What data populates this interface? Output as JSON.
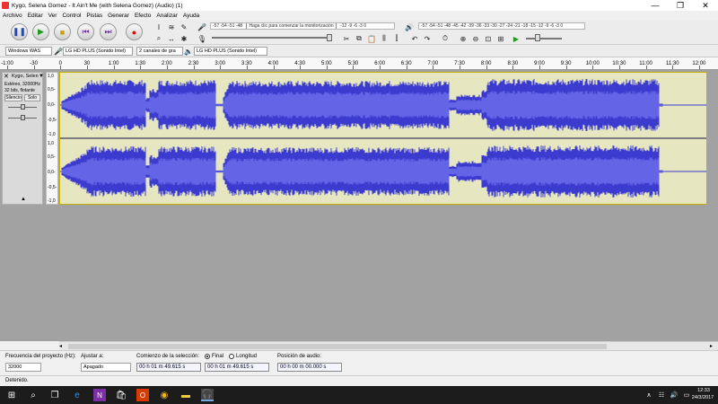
{
  "window": {
    "title": "Kygo, Selena Gomez - It Ain't Me (with Selena Gomez) (Audio) (1)",
    "controls": [
      "—",
      "❐",
      "✕"
    ]
  },
  "menu": [
    "Archivo",
    "Editar",
    "Ver",
    "Control",
    "Pistas",
    "Generar",
    "Efecto",
    "Analizar",
    "Ayuda"
  ],
  "toolbar": {
    "transport": [
      "pause-icon",
      "play-icon",
      "stop-icon",
      "skip-start-icon",
      "skip-end-icon",
      "record-icon"
    ],
    "record_meter_scale": "-57 -54 -51 -48",
    "record_meter_hint": "Haga clic para comenzar la monitorización",
    "record_meter_scale2": "-12 -9 -6 -3 0",
    "play_meter_scale": "-57 -54 -51 -48 -45 -42 -39 -36 -33 -30 -27 -24 -21 -18 -15 -12 -9 -6 -3 0"
  },
  "devices": {
    "host": "Windows WAS",
    "input": "LG HD PLUS (Sonido Intel)",
    "channels": "2 canales de gra",
    "output": "LG HD PLUS (Sonido Intel)"
  },
  "ruler": {
    "labels": [
      "-1:00",
      "-30",
      "0",
      "30",
      "1:00",
      "1:30",
      "2:00",
      "2:30",
      "3:00",
      "3:30",
      "4:00",
      "4:30",
      "5:00",
      "5:30",
      "6:00",
      "6:30",
      "7:00",
      "7:30",
      "8:00",
      "8:30",
      "9:00",
      "9:30",
      "10:00",
      "10:30",
      "11:00",
      "11:30",
      "12:00"
    ]
  },
  "track": {
    "name": "Kygo, Selen",
    "info1": "Estéreo, 32000Hz",
    "info2": "32 bits, flotante",
    "mute_label": "Silencio",
    "solo_label": "Solo",
    "scale_top": [
      "1,0",
      "0,5-",
      "0,0-",
      "-0,5-",
      "-1,0"
    ],
    "scale_bottom": [
      "1,0",
      "0,5-",
      "0,0-",
      "-0,5-",
      "-1,0"
    ]
  },
  "selection": {
    "rate_label": "Frecuencia del proyecto (Hz):",
    "rate_value": "32000",
    "snap_label": "Ajustar a:",
    "snap_value": "Apagado",
    "start_label": "Comienzo de la selección:",
    "end_option": "Final",
    "length_option": "Longitud",
    "start_value": "00 h 01 m 49.615 s",
    "end_value": "00 h 01 m 49.615 s",
    "audio_pos_label": "Posición de audio:",
    "audio_pos_value": "00 h 00 m 00.000 s"
  },
  "status": "Detenido.",
  "taskbar": {
    "time": "12:33",
    "date": "24/3/2017"
  },
  "colors": {
    "waveform": "#3b3bd0",
    "waveform_rms": "#6464e6",
    "track_bg": "#e6e6c0",
    "tracks_area": "#a2a2a2"
  }
}
